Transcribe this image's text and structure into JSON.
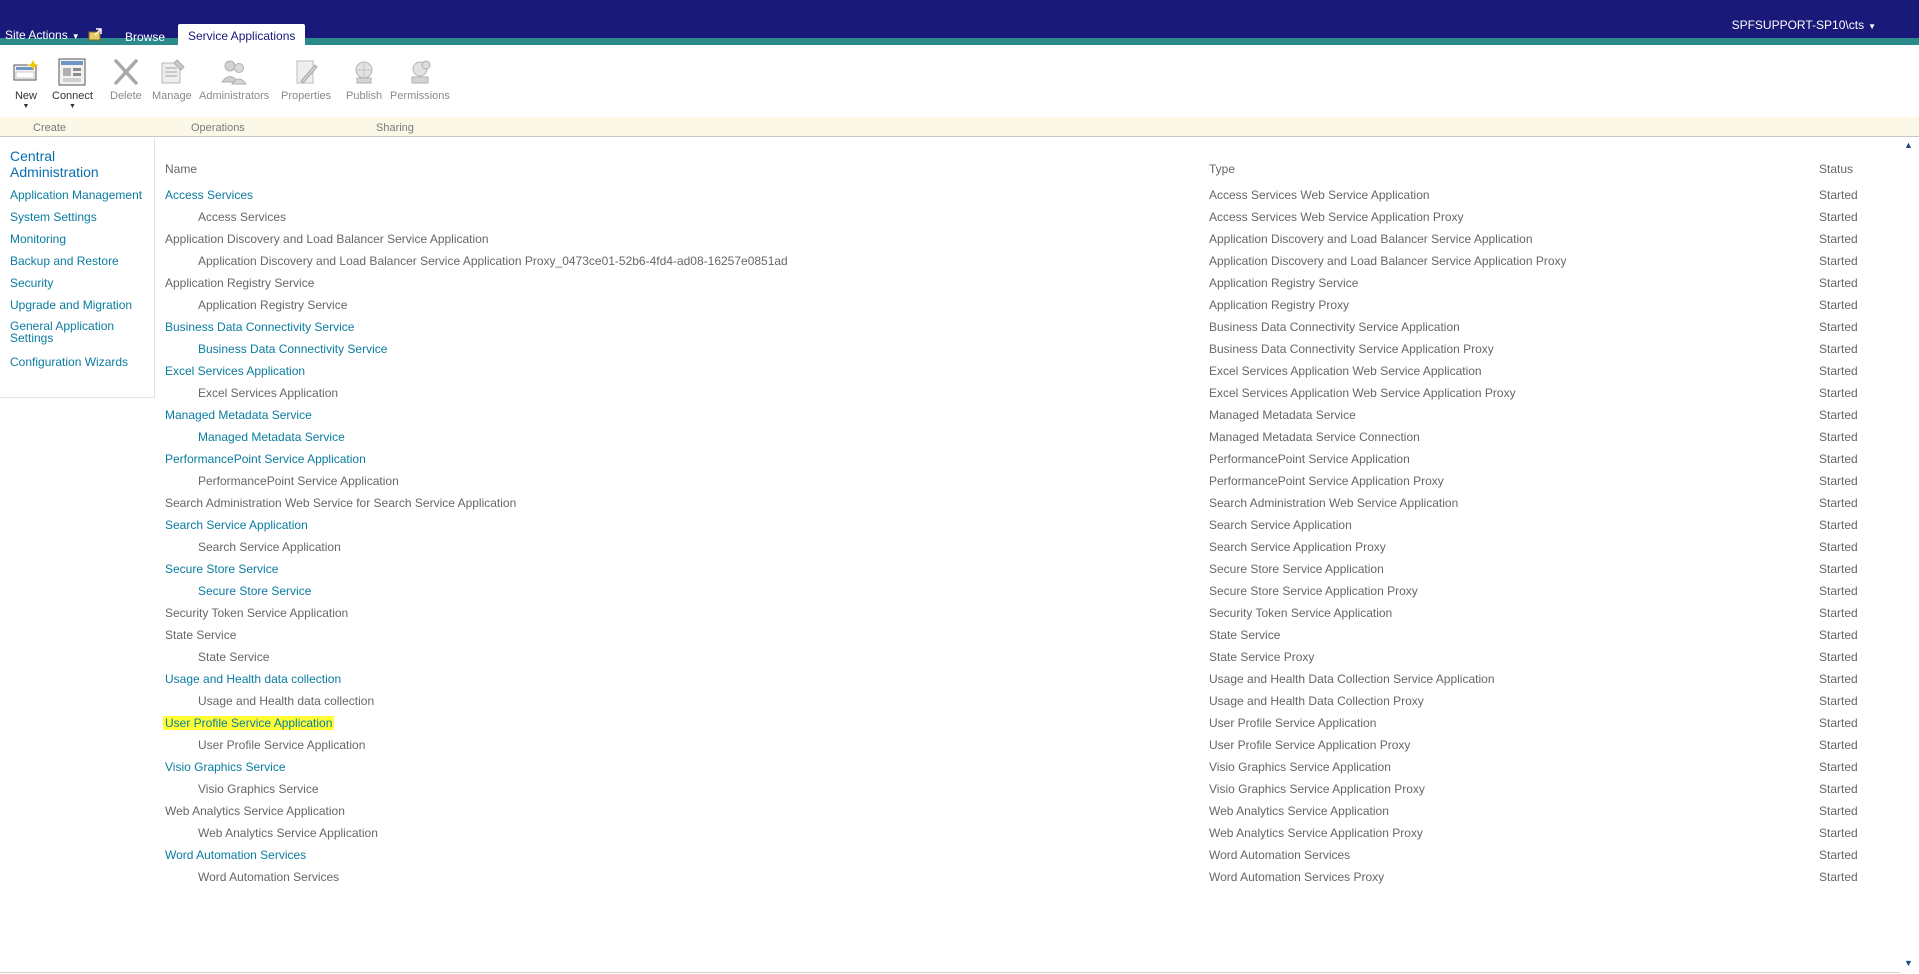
{
  "topbar": {
    "site_actions": "Site Actions",
    "browse": "Browse",
    "service_applications": "Service Applications",
    "user": "SPFSUPPORT-SP10\\cts"
  },
  "ribbon": {
    "buttons": [
      {
        "label": "New",
        "icon": "new-icon"
      },
      {
        "label": "Connect",
        "icon": "connect-icon"
      },
      {
        "label": "Delete",
        "icon": "delete-icon"
      },
      {
        "label": "Manage",
        "icon": "manage-icon"
      },
      {
        "label": "Administrators",
        "icon": "administrators-icon"
      },
      {
        "label": "Properties",
        "icon": "properties-icon"
      },
      {
        "label": "Publish",
        "icon": "publish-icon"
      },
      {
        "label": "Permissions",
        "icon": "permissions-icon"
      }
    ],
    "groups": [
      "Create",
      "Operations",
      "Sharing"
    ]
  },
  "leftnav": {
    "title": "Central Administration",
    "items": [
      "Application Management",
      "System Settings",
      "Monitoring",
      "Backup and Restore",
      "Security",
      "Upgrade and Migration",
      "General Application Settings",
      "Configuration Wizards"
    ]
  },
  "table": {
    "columns": [
      "Name",
      "Type",
      "Status"
    ],
    "rows": [
      {
        "name": "Access Services",
        "type": "Access Services Web Service Application",
        "status": "Started",
        "indent": false,
        "link": true
      },
      {
        "name": "Access Services",
        "type": "Access Services Web Service Application Proxy",
        "status": "Started",
        "indent": true,
        "link": false
      },
      {
        "name": "Application Discovery and Load Balancer Service Application",
        "type": "Application Discovery and Load Balancer Service Application",
        "status": "Started",
        "indent": false,
        "link": false
      },
      {
        "name": "Application Discovery and Load Balancer Service Application Proxy_0473ce01-52b6-4fd4-ad08-16257e0851ad",
        "type": "Application Discovery and Load Balancer Service Application Proxy",
        "status": "Started",
        "indent": true,
        "link": false
      },
      {
        "name": "Application Registry Service",
        "type": "Application Registry Service",
        "status": "Started",
        "indent": false,
        "link": false
      },
      {
        "name": "Application Registry Service",
        "type": "Application Registry Proxy",
        "status": "Started",
        "indent": true,
        "link": false
      },
      {
        "name": "Business Data Connectivity Service",
        "type": "Business Data Connectivity Service Application",
        "status": "Started",
        "indent": false,
        "link": true
      },
      {
        "name": "Business Data Connectivity Service",
        "type": "Business Data Connectivity Service Application Proxy",
        "status": "Started",
        "indent": true,
        "link": true
      },
      {
        "name": "Excel Services Application",
        "type": "Excel Services Application Web Service Application",
        "status": "Started",
        "indent": false,
        "link": true
      },
      {
        "name": "Excel Services Application",
        "type": "Excel Services Application Web Service Application Proxy",
        "status": "Started",
        "indent": true,
        "link": false
      },
      {
        "name": "Managed Metadata Service",
        "type": "Managed Metadata Service",
        "status": "Started",
        "indent": false,
        "link": true
      },
      {
        "name": "Managed Metadata Service",
        "type": "Managed Metadata Service Connection",
        "status": "Started",
        "indent": true,
        "link": true
      },
      {
        "name": "PerformancePoint Service Application",
        "type": "PerformancePoint Service Application",
        "status": "Started",
        "indent": false,
        "link": true
      },
      {
        "name": "PerformancePoint Service Application",
        "type": "PerformancePoint Service Application Proxy",
        "status": "Started",
        "indent": true,
        "link": false
      },
      {
        "name": "Search Administration Web Service for Search Service Application",
        "type": "Search Administration Web Service Application",
        "status": "Started",
        "indent": false,
        "link": false
      },
      {
        "name": "Search Service Application",
        "type": "Search Service Application",
        "status": "Started",
        "indent": false,
        "link": true
      },
      {
        "name": "Search Service Application",
        "type": "Search Service Application Proxy",
        "status": "Started",
        "indent": true,
        "link": false
      },
      {
        "name": "Secure Store Service",
        "type": "Secure Store Service Application",
        "status": "Started",
        "indent": false,
        "link": true
      },
      {
        "name": "Secure Store Service",
        "type": "Secure Store Service Application Proxy",
        "status": "Started",
        "indent": true,
        "link": true
      },
      {
        "name": "Security Token Service Application",
        "type": "Security Token Service Application",
        "status": "Started",
        "indent": false,
        "link": false
      },
      {
        "name": "State Service",
        "type": "State Service",
        "status": "Started",
        "indent": false,
        "link": false
      },
      {
        "name": "State Service",
        "type": "State Service Proxy",
        "status": "Started",
        "indent": true,
        "link": false
      },
      {
        "name": "Usage and Health data collection",
        "type": "Usage and Health Data Collection Service Application",
        "status": "Started",
        "indent": false,
        "link": true
      },
      {
        "name": "Usage and Health data collection",
        "type": "Usage and Health Data Collection Proxy",
        "status": "Started",
        "indent": true,
        "link": false
      },
      {
        "name": "User Profile Service Application",
        "type": "User Profile Service Application",
        "status": "Started",
        "indent": false,
        "link": true,
        "highlight": true
      },
      {
        "name": "User Profile Service Application",
        "type": "User Profile Service Application Proxy",
        "status": "Started",
        "indent": true,
        "link": false
      },
      {
        "name": "Visio Graphics Service",
        "type": "Visio Graphics Service Application",
        "status": "Started",
        "indent": false,
        "link": true
      },
      {
        "name": "Visio Graphics Service",
        "type": "Visio Graphics Service Application Proxy",
        "status": "Started",
        "indent": true,
        "link": false
      },
      {
        "name": "Web Analytics Service Application",
        "type": "Web Analytics Service Application",
        "status": "Started",
        "indent": false,
        "link": false
      },
      {
        "name": "Web Analytics Service Application",
        "type": "Web Analytics Service Application Proxy",
        "status": "Started",
        "indent": true,
        "link": false
      },
      {
        "name": "Word Automation Services",
        "type": "Word Automation Services",
        "status": "Started",
        "indent": false,
        "link": true
      },
      {
        "name": "Word Automation Services",
        "type": "Word Automation Services Proxy",
        "status": "Started",
        "indent": true,
        "link": false
      }
    ]
  },
  "colors": {
    "topbar": "#19197a",
    "accent_stripe": "#2c8a8a",
    "link": "#0a7ca0",
    "highlight": "#ffff33"
  }
}
